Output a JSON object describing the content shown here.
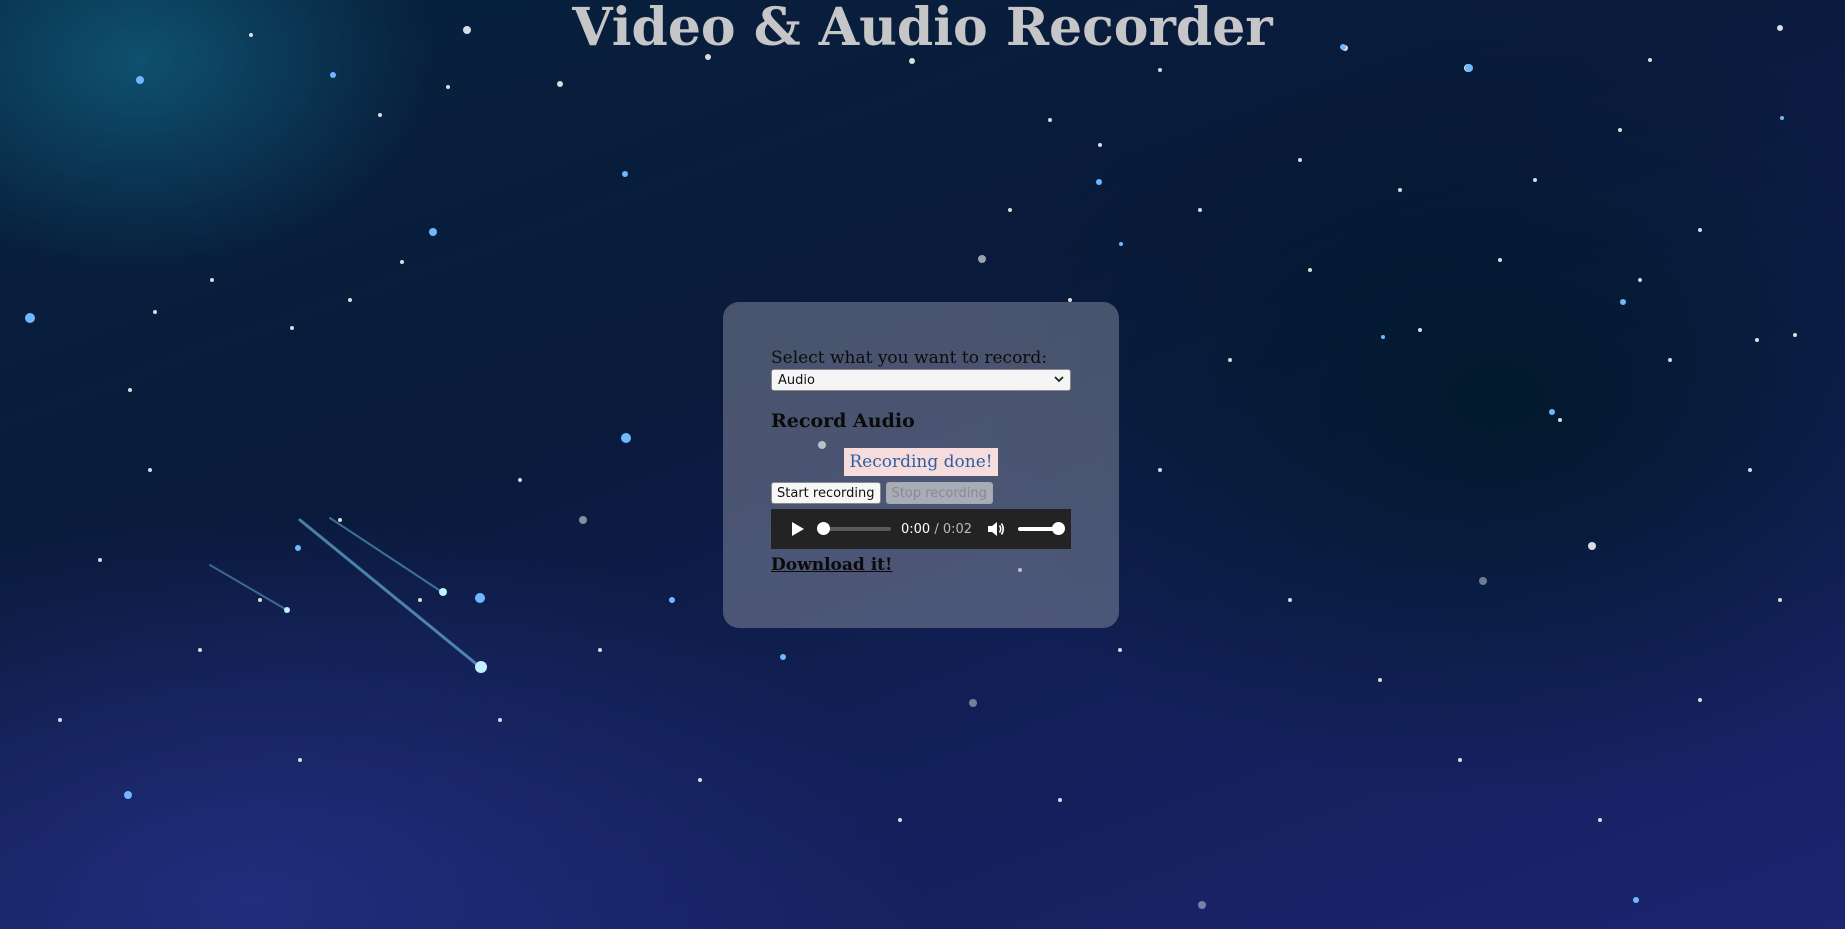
{
  "page": {
    "title": "Video & Audio Recorder"
  },
  "recorder": {
    "select_label": "Select what you want to record:",
    "select_value": "Audio",
    "section_title": "Record Audio",
    "status_text": "Recording done!",
    "start_button": "Start recording",
    "stop_button": "Stop recording",
    "download_link": "Download it!"
  },
  "player": {
    "current_time": "0:00",
    "separator": " / ",
    "duration": "0:02",
    "progress_fraction": 0,
    "volume_fraction": 1
  },
  "icons": {
    "play": "play-icon",
    "volume": "volume-icon",
    "select_chevron": "chevron-down-icon"
  },
  "colors": {
    "status_background": "#f6dcdc",
    "status_text": "#2f5fa3",
    "title": "#c6c6c8",
    "player_background": "#232323"
  }
}
